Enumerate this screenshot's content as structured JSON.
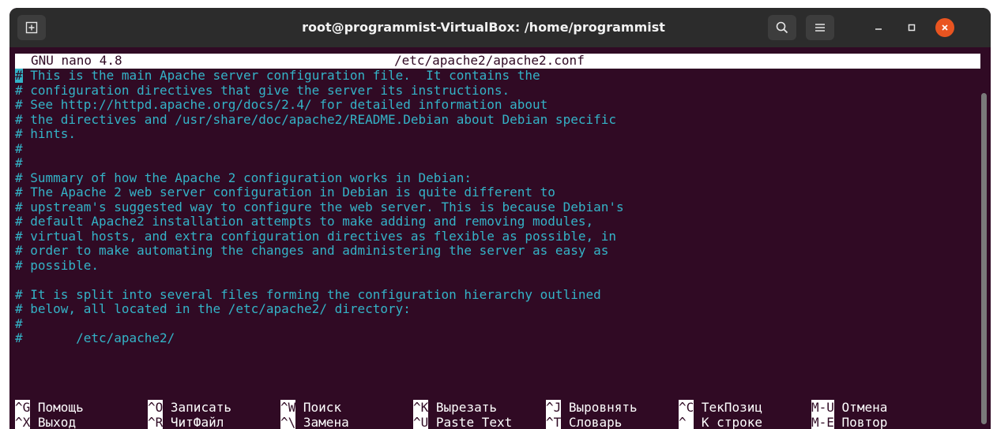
{
  "window": {
    "title": "root@programmist-VirtualBox: /home/programmist",
    "icons": [
      "new-tab-icon",
      "search-icon",
      "hamburger-menu-icon",
      "minimize-icon",
      "maximize-icon",
      "close-icon"
    ],
    "colors": {
      "titlebar": "#2c2c2c",
      "terminal_bg": "#300a24",
      "comment_text": "#34b3c7",
      "close_button": "#e95420"
    }
  },
  "nano": {
    "version": "GNU nano 4.8",
    "filename": "/etc/apache2/apache2.conf"
  },
  "content": {
    "lines": [
      " This is the main Apache server configuration file.  It contains the",
      "# configuration directives that give the server its instructions.",
      "# See http://httpd.apache.org/docs/2.4/ for detailed information about",
      "# the directives and /usr/share/doc/apache2/README.Debian about Debian specific",
      "# hints.",
      "#",
      "#",
      "# Summary of how the Apache 2 configuration works in Debian:",
      "# The Apache 2 web server configuration in Debian is quite different to",
      "# upstream's suggested way to configure the web server. This is because Debian's",
      "# default Apache2 installation attempts to make adding and removing modules,",
      "# virtual hosts, and extra configuration directives as flexible as possible, in",
      "# order to make automating the changes and administering the server as easy as",
      "# possible.",
      "",
      "# It is split into several files forming the configuration hierarchy outlined",
      "# below, all located in the /etc/apache2/ directory:",
      "#",
      "#       /etc/apache2/"
    ],
    "cursor_char": "#"
  },
  "shortcuts": {
    "row1": [
      {
        "key": "^G",
        "label": "Помощь"
      },
      {
        "key": "^O",
        "label": "Записать"
      },
      {
        "key": "^W",
        "label": "Поиск"
      },
      {
        "key": "^K",
        "label": "Вырезать"
      },
      {
        "key": "^J",
        "label": "Выровнять"
      },
      {
        "key": "^C",
        "label": "ТекПозиц"
      },
      {
        "key": "M-U",
        "label": "Отмена"
      }
    ],
    "row2": [
      {
        "key": "^X",
        "label": "Выход"
      },
      {
        "key": "^R",
        "label": "ЧитФайл"
      },
      {
        "key": "^\\",
        "label": "Замена"
      },
      {
        "key": "^U",
        "label": "Paste Text"
      },
      {
        "key": "^T",
        "label": "Словарь"
      },
      {
        "key": "^_",
        "label": "К строке"
      },
      {
        "key": "M-E",
        "label": "Повтор"
      }
    ]
  }
}
